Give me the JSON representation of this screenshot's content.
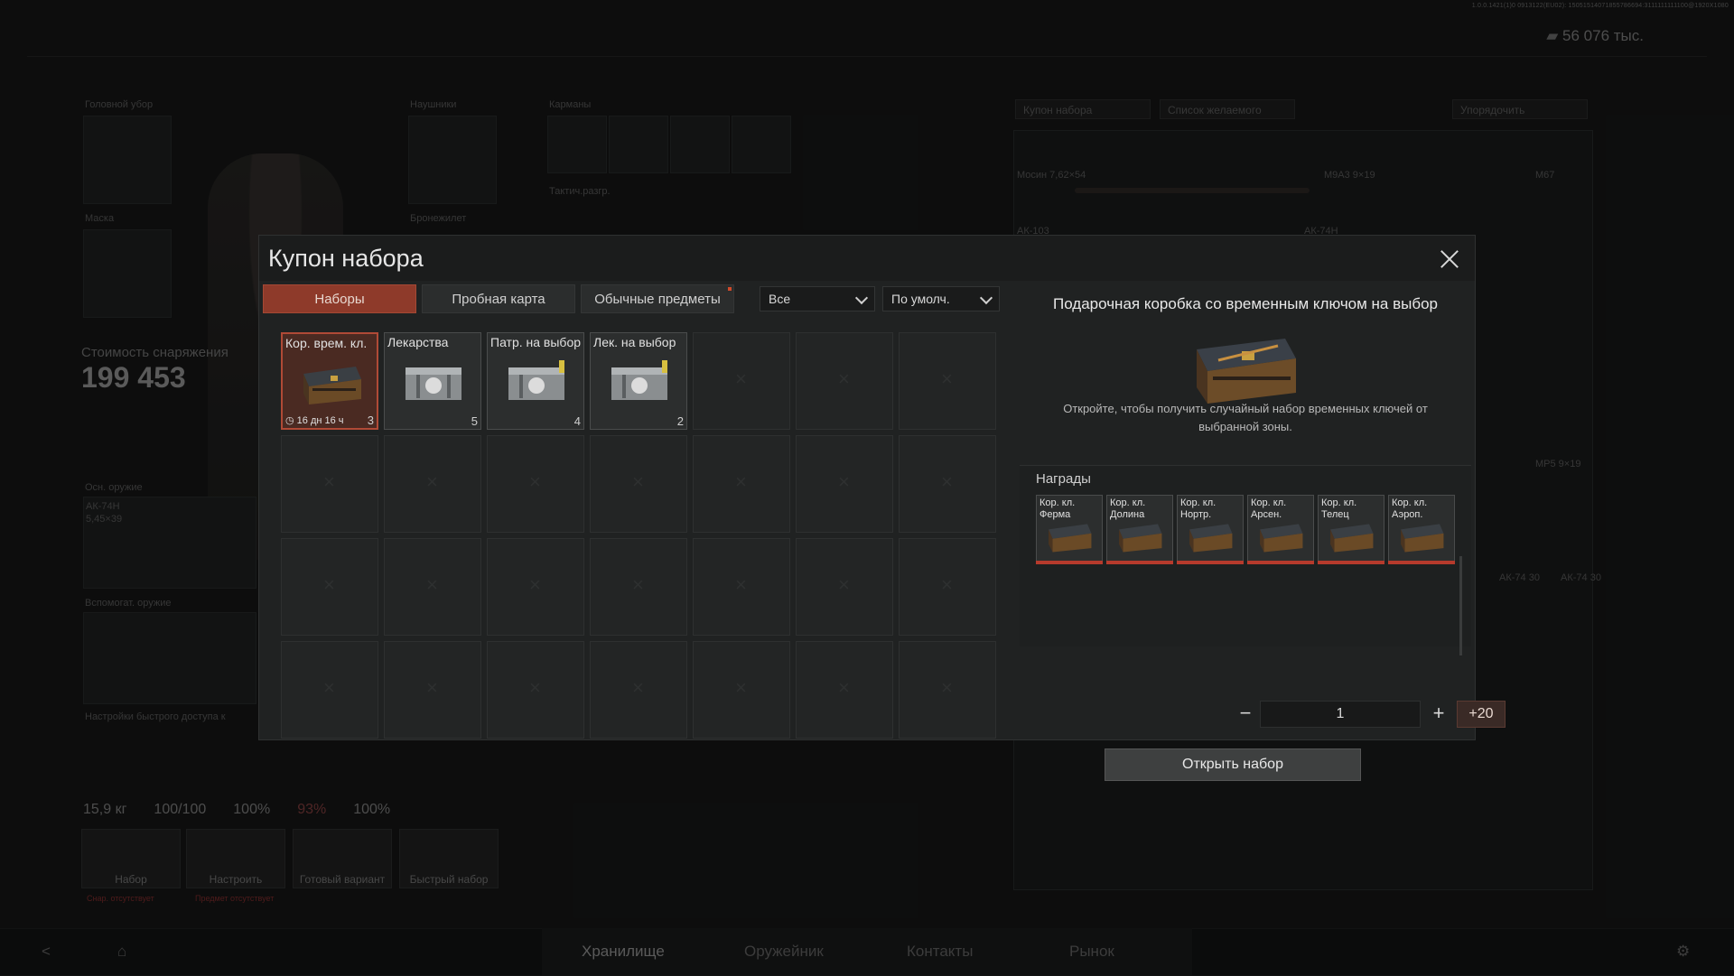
{
  "background": {
    "version": "1.0.0.1421(1)0 0913122(EU02): 15051514071855786694:3111111111100@1920X1080",
    "money": "56 076 тыс.",
    "equipment": {
      "headwear_label": "Головной убор",
      "earpiece_label": "Наушники",
      "pockets_label": "Карманы",
      "mask_label": "Маска",
      "vest_label": "Бронежилет",
      "tactical_rig_label": "Тактич.разгр.",
      "gear_value_label": "Стоимость снаряжения",
      "gear_value": "199 453",
      "primary_weapon_label": "Осн. оружие",
      "primary_weapon_name": "АК-74Н",
      "primary_weapon_ammo": "5,45×39",
      "secondary_weapon_label": "Вспомогат. оружие",
      "quickslots_label": "Настройки быстрого доступа к"
    },
    "stats": [
      "15,9 кг",
      "100/100",
      "100%",
      "93%",
      "100%"
    ],
    "actions": [
      {
        "label": "Набор",
        "sub": "Снар. отсутствует"
      },
      {
        "label": "Настроить",
        "sub": "Предмет отсутствует"
      },
      {
        "label": "Готовый вариант",
        "sub": ""
      },
      {
        "label": "Быстрый набор",
        "sub": ""
      }
    ],
    "storage_toolbar": [
      "Купон набора",
      "Список желаемого",
      "Упорядочить"
    ],
    "storage_items": [
      "Мосин 7,62×54",
      "М9А3 9×19",
      "М67",
      "АК-103",
      "АК-74Н",
      "АК-74 30",
      "АК-74 30",
      "МР5 9×19"
    ],
    "bottom_tabs": [
      "Хранилище",
      "Оружейник",
      "Контакты",
      "Рынок"
    ],
    "active_bottom_tab": "Хранилище"
  },
  "modal": {
    "title": "Купон набора",
    "tabs": [
      {
        "label": "Наборы",
        "active": true
      },
      {
        "label": "Пробная карта",
        "active": false
      },
      {
        "label": "Обычные предметы",
        "active": false,
        "has_dot": true
      }
    ],
    "filter_type": "Все",
    "filter_sort": "По умолч.",
    "items": [
      {
        "label": "Кор. врем. кл.",
        "count": "3",
        "timer": "16 дн 16 ч",
        "selected": true,
        "style": "wood"
      },
      {
        "label": "Лекарства",
        "count": "5",
        "selected": false,
        "style": "metal"
      },
      {
        "label": "Патр. на выбор",
        "count": "4",
        "selected": false,
        "style": "metal"
      },
      {
        "label": "Лек. на выбор",
        "count": "2",
        "selected": false,
        "style": "metal"
      }
    ],
    "detail": {
      "title": "Подарочная коробка со временным ключом на выбор",
      "description": "Откройте, чтобы получить случайный набор временных ключей от выбранной зоны.",
      "rewards_label": "Награды",
      "rewards": [
        "Кор. кл. Ферма",
        "Кор. кл. Долина",
        "Кор. кл. Нортр.",
        "Кор. кл. Арсен.",
        "Кор. кл. Телец",
        "Кор. кл. Аэроп."
      ],
      "quantity": "1",
      "plus20": "+20",
      "open_button": "Открыть набор"
    }
  },
  "colors": {
    "accent": "#8e3a2a",
    "reward_bar": "#b63a2c",
    "panel": "#202222"
  }
}
